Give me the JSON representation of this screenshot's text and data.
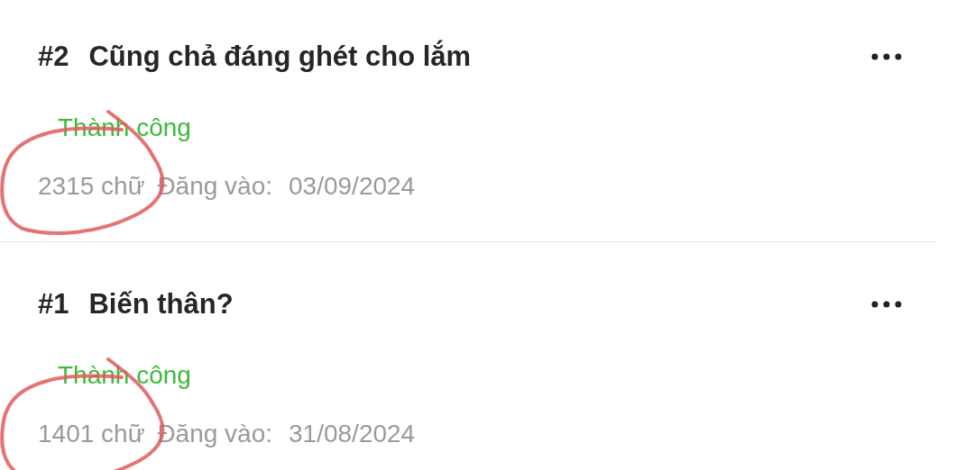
{
  "posts": [
    {
      "number": "#2",
      "title": "Cũng chả đáng ghét cho lắm",
      "status": "Thành công",
      "word_count": "2315 chữ",
      "posted_label": "Đăng vào:",
      "date": "03/09/2024",
      "circled": true
    },
    {
      "number": "#1",
      "title": "Biến thân?",
      "status": "Thành công",
      "word_count": "1401 chữ",
      "posted_label": "Đăng vào:",
      "date": "31/08/2024",
      "circled": true
    }
  ]
}
